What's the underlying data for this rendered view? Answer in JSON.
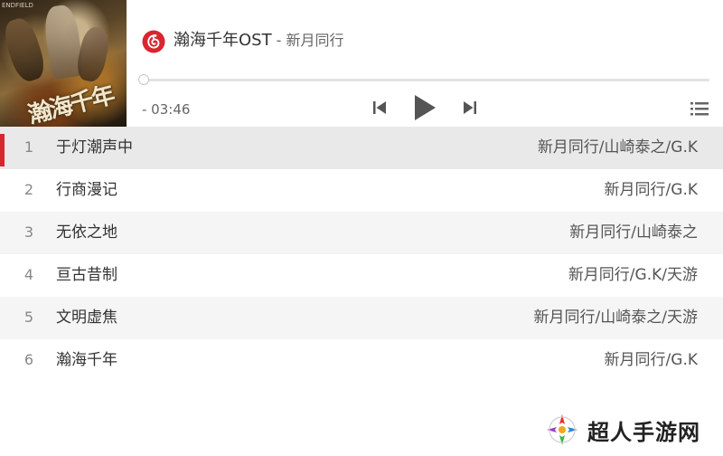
{
  "player": {
    "cover_title": "瀚海千年",
    "cover_tag": "ENDFIELD",
    "song_title": "瀚海千年OST",
    "separator": " - ",
    "artist": "新月同行",
    "time_display": "- 03:46",
    "progress": 0.0,
    "accent_color": "#d8262f",
    "icons": {
      "logo": "netease-music-logo-icon",
      "prev": "skip-previous-icon",
      "play": "play-icon",
      "next": "skip-next-icon",
      "playlist": "playlist-icon"
    }
  },
  "playlist": {
    "items": [
      {
        "index": "1",
        "name": "于灯潮声中",
        "artist": "新月同行/山崎泰之/G.K"
      },
      {
        "index": "2",
        "name": "行商漫记",
        "artist": "新月同行/G.K"
      },
      {
        "index": "3",
        "name": "无依之地",
        "artist": "新月同行/山崎泰之"
      },
      {
        "index": "4",
        "name": "亘古昔制",
        "artist": "新月同行/G.K/天游"
      },
      {
        "index": "5",
        "name": "文明虚焦",
        "artist": "新月同行/山崎泰之/天游"
      },
      {
        "index": "6",
        "name": "瀚海千年",
        "artist": "新月同行/G.K"
      }
    ],
    "active_index": 0
  },
  "watermark": {
    "text": "超人手游网",
    "icon": "site-logo-icon"
  }
}
